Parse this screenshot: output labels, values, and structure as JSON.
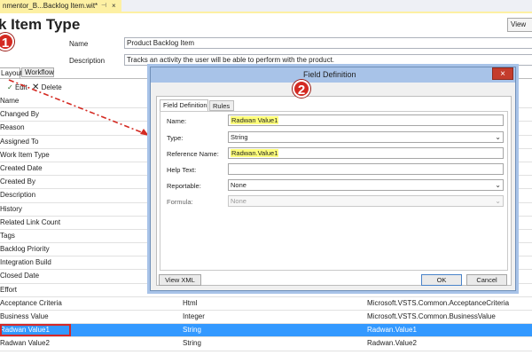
{
  "doc_tab": {
    "label": "nmentor_B...Backlog Item.wit*",
    "pin_glyph": "⊣",
    "close_glyph": "×"
  },
  "header": {
    "title": "k Item Type",
    "view_button": "View",
    "name_label": "Name",
    "name_value": "Product Backlog Item",
    "description_label": "Description",
    "description_value": "Tracks an activity the user will be able to perform with the product."
  },
  "tabs": {
    "layout": "Layout",
    "workflow": "Workflow"
  },
  "toolbar": {
    "edit": "Edit",
    "delete": "Delete"
  },
  "grid": {
    "header": {
      "c1": "Name",
      "c2": "",
      "c3": ""
    },
    "rows": [
      {
        "c1": "Changed By",
        "c2": "",
        "c3": ""
      },
      {
        "c1": "Reason",
        "c2": "",
        "c3": ""
      },
      {
        "c1": "Assigned To",
        "c2": "",
        "c3": ""
      },
      {
        "c1": "Work Item Type",
        "c2": "",
        "c3": ""
      },
      {
        "c1": "Created Date",
        "c2": "",
        "c3": ""
      },
      {
        "c1": "Created By",
        "c2": "",
        "c3": ""
      },
      {
        "c1": "Description",
        "c2": "",
        "c3": ""
      },
      {
        "c1": "History",
        "c2": "",
        "c3": ""
      },
      {
        "c1": "Related Link Count",
        "c2": "",
        "c3": ""
      },
      {
        "c1": "Tags",
        "c2": "",
        "c3": ""
      },
      {
        "c1": "Backlog Priority",
        "c2": "",
        "c3": ""
      },
      {
        "c1": "Integration Build",
        "c2": "",
        "c3": ""
      },
      {
        "c1": "Closed Date",
        "c2": "",
        "c3": ""
      },
      {
        "c1": "Effort",
        "c2": "",
        "c3": ""
      },
      {
        "c1": "Acceptance Criteria",
        "c2": "Html",
        "c3": "Microsoft.VSTS.Common.AcceptanceCriteria"
      },
      {
        "c1": "Business Value",
        "c2": "Integer",
        "c3": "Microsoft.VSTS.Common.BusinessValue"
      },
      {
        "c1": "Radwan Value1",
        "c2": "String",
        "c3": "Radwan.Value1",
        "selected": true
      },
      {
        "c1": "Radwan Value2",
        "c2": "String",
        "c3": "Radwan.Value2"
      }
    ]
  },
  "dialog": {
    "title": "Field Definition",
    "close_glyph": "×",
    "tabs": {
      "field_definition": "Field Definition",
      "rules": "Rules"
    },
    "fields": {
      "name_label": "Name:",
      "name_value": "Radwan Value1",
      "type_label": "Type:",
      "type_value": "String",
      "ref_label": "Reference Name:",
      "ref_value": "Radwan.Value1",
      "help_label": "Help Text:",
      "help_value": "",
      "reportable_label": "Reportable:",
      "reportable_value": "None",
      "formula_label": "Formula:",
      "formula_value": "None"
    },
    "buttons": {
      "view_xml": "View XML",
      "ok": "OK",
      "cancel": "Cancel"
    }
  },
  "annotations": {
    "badge1": "1",
    "badge2": "2"
  },
  "colors": {
    "selection": "#3399ff",
    "highlight": "#ffff7a",
    "annotation_red": "#d42a22",
    "doc_tab": "#fdf0a3"
  },
  "icons": [
    "pin-icon",
    "close-icon",
    "check-icon",
    "delete-x-icon",
    "dropdown-caret-icon",
    "dialog-close-icon"
  ]
}
